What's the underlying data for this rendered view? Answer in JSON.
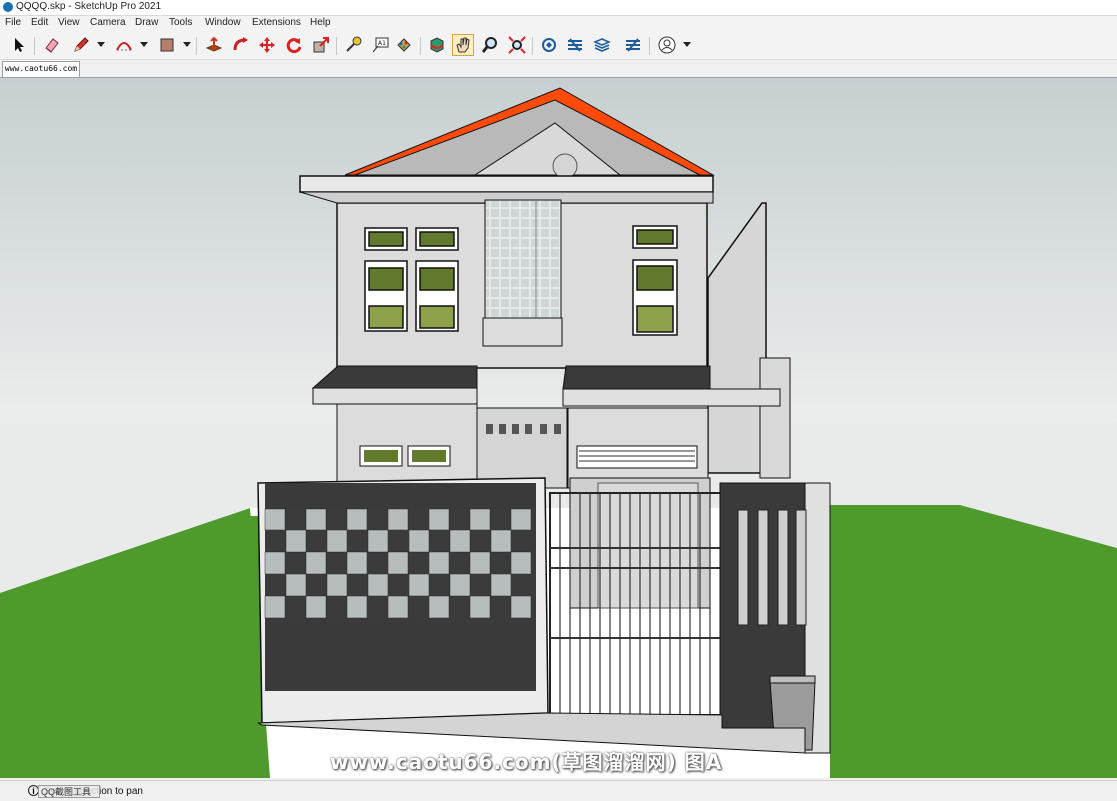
{
  "window": {
    "title": "QQQQ.skp - SketchUp Pro 2021"
  },
  "menu": [
    "File",
    "Edit",
    "View",
    "Camera",
    "Draw",
    "Tools",
    "Window",
    "Extensions",
    "Help"
  ],
  "toolbar": {
    "tools": [
      "select-tool",
      "eraser-tool",
      "line-tool",
      "arc-tool",
      "rectangle-tool",
      "push-pull-tool",
      "follow-me-tool",
      "move-tool",
      "rotate-tool",
      "scale-tool",
      "tape-measure-tool",
      "text-tool",
      "paint-bucket-tool",
      "orbit-tool",
      "pan-tool",
      "zoom-tool",
      "zoom-extents-tool",
      "warehouse-tool",
      "extension-warehouse-tool",
      "layout-tool",
      "extension-manager-tool",
      "account-tool"
    ],
    "active_tool": "pan-tool"
  },
  "scene_tab": "www.caotu66.com",
  "status": {
    "info_icon": "i",
    "text": "Select direction to pan",
    "overlay": "QQ截图工具"
  },
  "watermark": "www.caotu66.com(草图溜溜网) 图A",
  "colors": {
    "sky_top": "#c8d0d2",
    "sky_bottom": "#e8ebea",
    "grass": "#4f9a2b",
    "roof": "#ff4a0a",
    "wall": "#dcdcdc",
    "fence_dark": "#3a3a3a"
  }
}
